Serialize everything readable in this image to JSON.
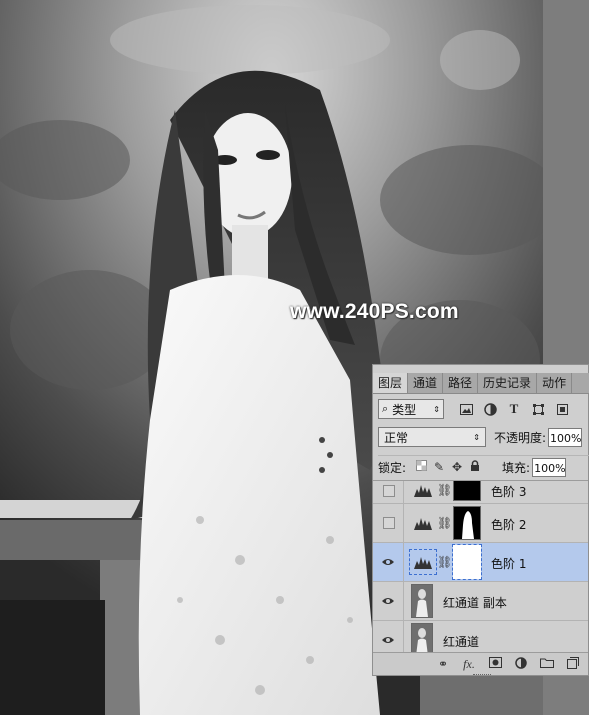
{
  "watermark": "www.240PS.com",
  "panel": {
    "tabs": [
      {
        "label": "图层",
        "active": true
      },
      {
        "label": "通道",
        "active": false
      },
      {
        "label": "路径",
        "active": false
      },
      {
        "label": "历史记录",
        "active": false
      },
      {
        "label": "动作",
        "active": false
      }
    ],
    "kind_filter": "类型",
    "filter_icons": [
      "image-filter-icon",
      "adjustment-filter-icon",
      "text-filter-icon",
      "shape-filter-icon",
      "smartobject-filter-icon"
    ],
    "blend_mode": "正常",
    "opacity_label": "不透明度:",
    "opacity_value": "100%",
    "lock_label": "锁定:",
    "fill_label": "填充:",
    "fill_value": "100%",
    "layers": [
      {
        "name": "色阶 3",
        "visible": false,
        "type": "adjustment",
        "mask": "black",
        "selected": false
      },
      {
        "name": "色阶 2",
        "visible": false,
        "type": "adjustment",
        "mask": "silhouette",
        "selected": false
      },
      {
        "name": "色阶 1",
        "visible": true,
        "type": "adjustment",
        "mask": "white",
        "selected": true
      },
      {
        "name": "红通道 副本",
        "visible": true,
        "type": "pixel",
        "selected": false
      },
      {
        "name": "红通道",
        "visible": true,
        "type": "pixel",
        "selected": false
      }
    ],
    "bottom_icons": [
      "link-layers-icon",
      "fx-icon",
      "add-mask-icon",
      "new-adjustment-icon",
      "new-group-icon",
      "new-layer-icon"
    ]
  },
  "colors": {
    "panel_bg": "#cfcfcf",
    "tab_bar": "#a8a8a8",
    "selected_layer": "#b4c9ec"
  }
}
